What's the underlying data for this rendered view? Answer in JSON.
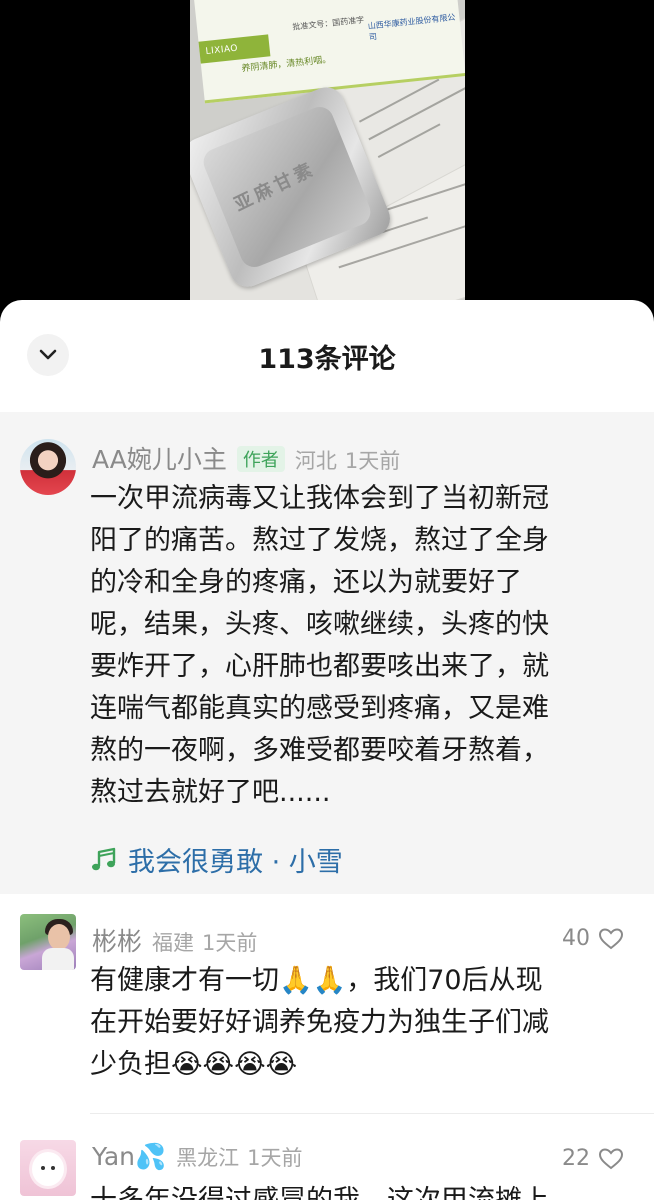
{
  "video": {
    "box_brand": "LIXIAO",
    "box_slogan": "养阴清肺，清热利咽。",
    "box_approval": "批准文号：国药准字",
    "box_maker": "山西华康药业股份有限公司",
    "blister_text": "亚麻甘素"
  },
  "sheet": {
    "title": "113条评论",
    "collapse_icon": "chevron-down-icon"
  },
  "comments": [
    {
      "user": "AA婉儿小主",
      "badge": "作者",
      "location": "河北",
      "time": "1天前",
      "lines": [
        "一次甲流病毒又让我体会到了当初新冠",
        "阳了的痛苦。熬过了发烧，熬过了全身",
        "的冷和全身的疼痛，还以为就要好了",
        "呢，结果，头疼、咳嗽继续，头疼的快",
        "要炸开了，心肝肺也都要咳出来了，就",
        "连喘气都能真实的感受到疼痛，又是难",
        "熬的一夜啊，多难受都要咬着牙熬着，",
        "熬过去就好了吧......"
      ],
      "music": "我会很勇敢 · 小雪",
      "music_icon": "music-note-icon"
    },
    {
      "user": "彬彬",
      "location": "福建",
      "time": "1天前",
      "likes": "40",
      "lines": [
        "有健康才有一切🙏🙏，我们70后从现",
        "在开始要好好调养免疫力为独生子们减",
        "少负担😭😭😭😭"
      ]
    },
    {
      "user": "Yan💦",
      "location": "黑龙江",
      "time": "1天前",
      "likes": "22",
      "lines": [
        "十多年没得过感冒的我，这次甲流摊上"
      ]
    }
  ],
  "icons": {
    "like": "heart-outline-icon"
  },
  "colors": {
    "author_badge": "#3ea35a",
    "music_link": "#2d6ea8",
    "pinned_bg": "#f5f5f5"
  }
}
